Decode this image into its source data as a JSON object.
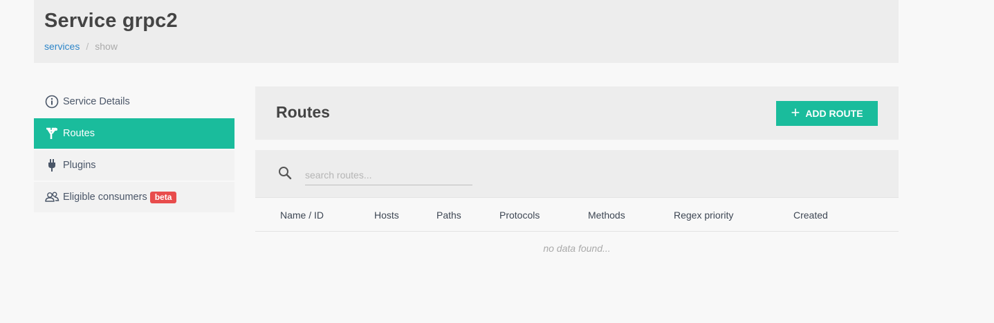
{
  "header": {
    "title": "Service grpc2",
    "breadcrumb": {
      "link": "services",
      "separator": "/",
      "current": "show"
    }
  },
  "sidebar": {
    "items": [
      {
        "label": "Service Details",
        "icon": "info-circle-icon"
      },
      {
        "label": "Routes",
        "icon": "routes-icon"
      },
      {
        "label": "Plugins",
        "icon": "plug-icon"
      },
      {
        "label": "Eligible consumers",
        "icon": "users-icon",
        "badge": "beta"
      }
    ],
    "active_index": 1
  },
  "routes": {
    "title": "Routes",
    "add_button": {
      "icon": "+",
      "label": "ADD ROUTE"
    },
    "search": {
      "placeholder": "search routes..."
    },
    "columns": [
      "Name / ID",
      "Hosts",
      "Paths",
      "Protocols",
      "Methods",
      "Regex priority",
      "Created"
    ],
    "empty_text": "no data found..."
  },
  "colors": {
    "accent": "#1abc9c",
    "badge": "#e84c4c",
    "link": "#2e86c9"
  }
}
